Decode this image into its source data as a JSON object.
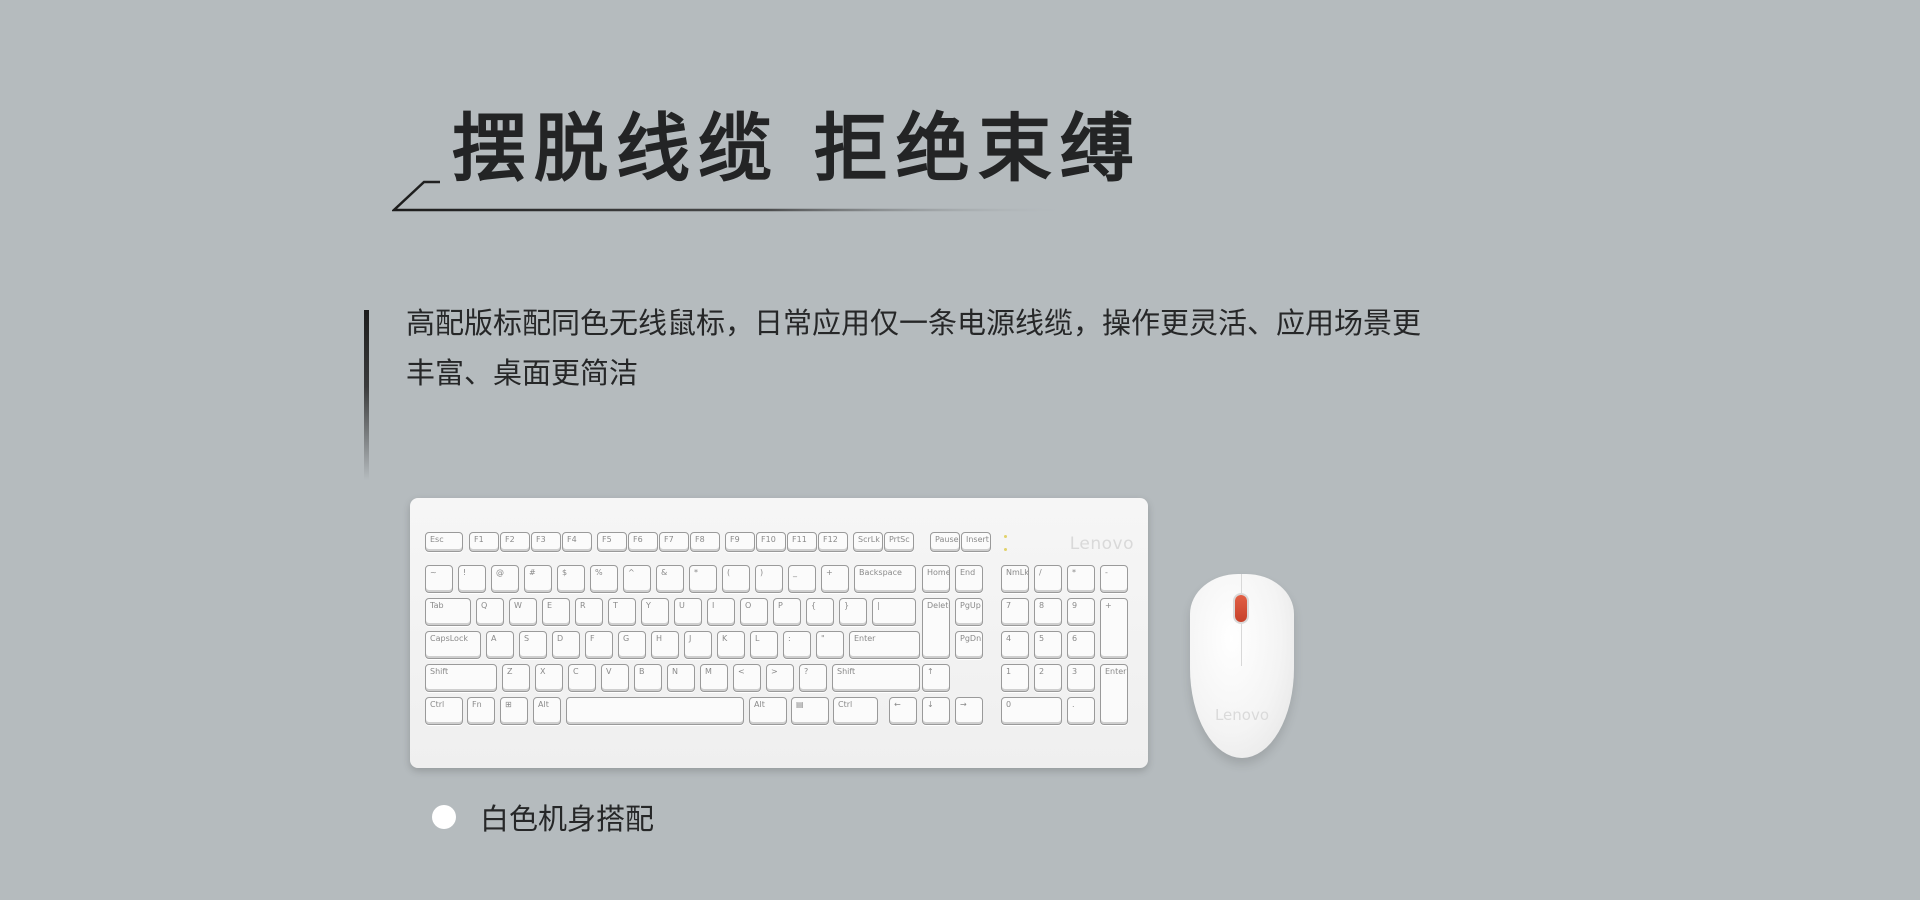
{
  "headline": "摆脱线缆 拒绝束缚",
  "description": "高配版标配同色无线鼠标，日常应用仅一条电源线缆，操作更灵活、应用场景更丰富、桌面更简洁",
  "keyboard": {
    "brand": "Lenovo",
    "keys": [
      "Esc",
      "F1",
      "F2",
      "F3",
      "F4",
      "F5",
      "F6",
      "F7",
      "F8",
      "F9",
      "F10",
      "F11",
      "F12",
      "ScrLk",
      "PrtSc",
      "Pause",
      "Insert",
      "~",
      "!",
      "@",
      "#",
      "$",
      "%",
      "^",
      "&",
      "*",
      "(",
      ")",
      "_",
      "+",
      "Backspace",
      "Home",
      "End",
      "NmLk",
      "/",
      "*",
      "-",
      "Tab",
      "Q",
      "W",
      "E",
      "R",
      "T",
      "Y",
      "U",
      "I",
      "O",
      "P",
      "{",
      "}",
      "|",
      "Delete",
      "PgUp",
      "7",
      "8",
      "9",
      "+",
      "CapsLock",
      "A",
      "S",
      "D",
      "F",
      "G",
      "H",
      "J",
      "K",
      "L",
      ":",
      "\"",
      "Enter",
      "PgDn",
      "4",
      "5",
      "6",
      "Shift",
      "Z",
      "X",
      "C",
      "V",
      "B",
      "N",
      "M",
      "<",
      ">",
      "?",
      "Shift",
      "↑",
      "1",
      "2",
      "3",
      "Enter",
      "Ctrl",
      "Fn",
      "⊞",
      "Alt",
      "",
      "Alt",
      "▤",
      "Ctrl",
      "←",
      "↓",
      "→",
      "0",
      "."
    ]
  },
  "mouse": {
    "brand": "Lenovo"
  },
  "color_option": {
    "label": "白色机身搭配",
    "swatch": "#ffffff"
  }
}
